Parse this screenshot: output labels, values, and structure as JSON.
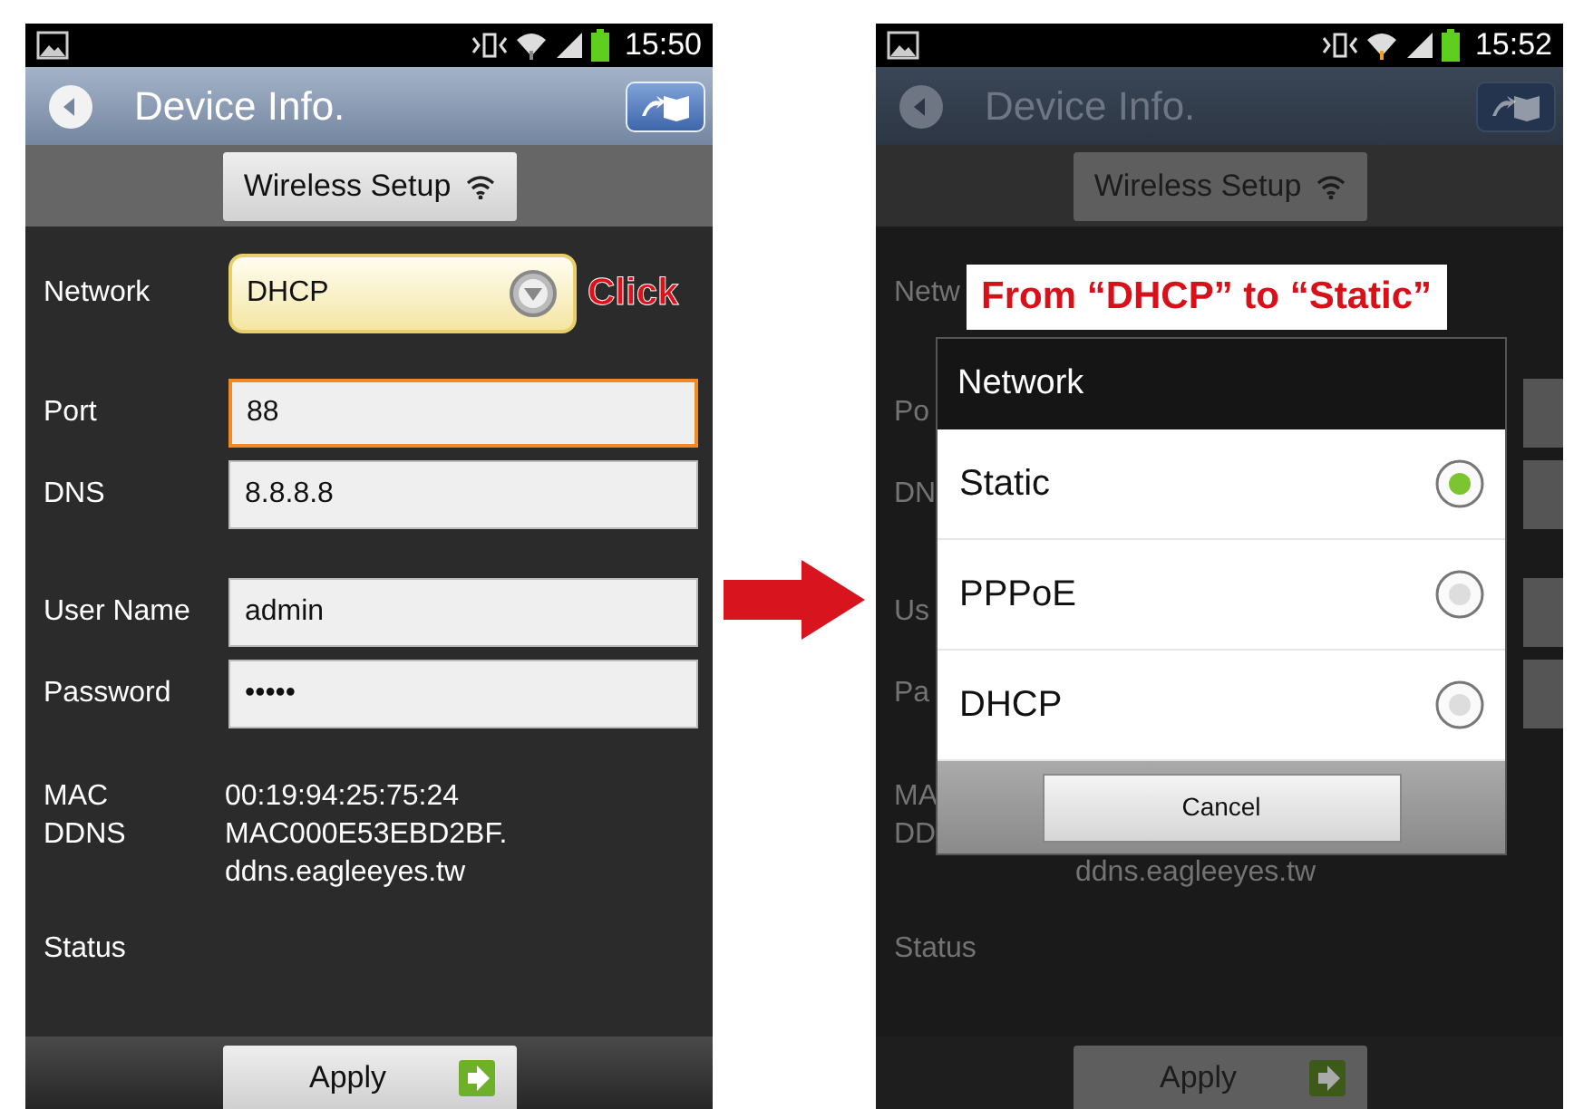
{
  "screens": [
    {
      "kind": "form",
      "status_bar": {
        "time": "15:50"
      },
      "title": "Device Info.",
      "tab_button": "Wireless Setup",
      "callout": "Click",
      "rows": [
        {
          "kind": "select",
          "label": "Network",
          "value": "DHCP"
        },
        {
          "kind": "field",
          "label": "Port",
          "value": "88",
          "focused": true
        },
        {
          "kind": "field",
          "label": "DNS",
          "value": "8.8.8.8",
          "focused": false
        },
        {
          "kind": "field",
          "label": "User Name",
          "value": "admin",
          "focused": false
        },
        {
          "kind": "field",
          "label": "Password",
          "value": "•••••",
          "focused": false
        }
      ],
      "info": [
        {
          "label": "MAC",
          "lines": [
            "00:19:94:25:75:24"
          ]
        },
        {
          "label": "DDNS",
          "lines": [
            "MAC000E53EBD2BF.",
            "ddns.eagleeyes.tw"
          ]
        },
        {
          "label": "Status"
        }
      ],
      "apply": "Apply"
    },
    {
      "kind": "dialog",
      "status_bar": {
        "time": "15:52"
      },
      "title": "Device Info.",
      "tab_button": "Wireless Setup",
      "callout": "From “DHCP” to “Static”",
      "rows": [
        {
          "kind": "select",
          "label": "Netw"
        },
        {
          "kind": "field",
          "label": "Po"
        },
        {
          "kind": "field",
          "label": "DN"
        },
        {
          "kind": "field",
          "label": "Us"
        },
        {
          "kind": "field",
          "label": "Pa"
        }
      ],
      "info": [
        {
          "label": "MA"
        },
        {
          "label": "DD"
        },
        {
          "lines": [
            "ddns.eagleeyes.tw"
          ]
        },
        {
          "label": "Status"
        }
      ],
      "dialog": {
        "title": "Network",
        "options": [
          {
            "label": "Static",
            "selected": true
          },
          {
            "label": "PPPoE",
            "selected": false
          },
          {
            "label": "DHCP",
            "selected": false
          }
        ],
        "cancel": "Cancel"
      },
      "apply": "Apply"
    }
  ]
}
